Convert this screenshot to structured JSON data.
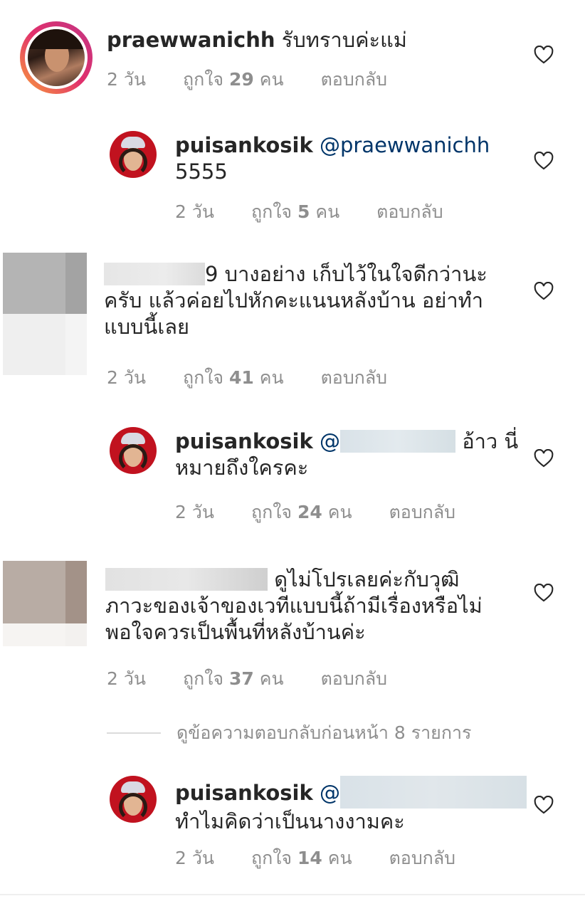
{
  "colors": {
    "text": "#262626",
    "meta": "#8e8e8e",
    "mention": "#003569",
    "divider": "#dbdbdb"
  },
  "comments": [
    {
      "user": "praewwanichh",
      "text": "รับทราบค่ะแม่",
      "time": "2 วัน",
      "likes_prefix": "ถูกใจ",
      "likes_count": "29",
      "likes_suffix": "คน",
      "reply": "ตอบกลับ"
    },
    {
      "user": "puisankosik",
      "mention": "@praewwanichh",
      "text": "5555",
      "time": "2 วัน",
      "likes_prefix": "ถูกใจ",
      "likes_count": "5",
      "likes_suffix": "คน",
      "reply": "ตอบกลับ"
    },
    {
      "text_line1": "9 บางอย่าง เก็บไว้ในใจดีกว่านะ",
      "text_line2": "ครับ แล้วค่อยไปหักคะแนนหลังบ้าน อย่าทำ",
      "text_line3": "แบบนี้เลย",
      "time": "2 วัน",
      "likes_prefix": "ถูกใจ",
      "likes_count": "41",
      "likes_suffix": "คน",
      "reply": "ตอบกลับ"
    },
    {
      "user": "puisankosik",
      "mention": "@",
      "text_line1": "อ้าว นี่",
      "text_line2": "หมายถึงใครคะ",
      "time": "2 วัน",
      "likes_prefix": "ถูกใจ",
      "likes_count": "24",
      "likes_suffix": "คน",
      "reply": "ตอบกลับ"
    },
    {
      "text_line1": "ดูไม่โปรเลยค่ะกับวุฒิ",
      "text_line2": "ภาวะของเจ้าของเวทีแบบนี้ถ้ามีเรื่องหรือไม่",
      "text_line3": "พอใจควรเป็นพื้นที่หลังบ้านค่ะ",
      "time": "2 วัน",
      "likes_prefix": "ถูกใจ",
      "likes_count": "37",
      "likes_suffix": "คน",
      "reply": "ตอบกลับ"
    },
    {
      "user": "puisankosik",
      "mention": "@",
      "text": "ทำไมคิดว่าเป็นนางงามคะ",
      "time": "2 วัน",
      "likes_prefix": "ถูกใจ",
      "likes_count": "14",
      "likes_suffix": "คน",
      "reply": "ตอบกลับ"
    }
  ],
  "view_previous": "ดูข้อความตอบกลับก่อนหน้า 8 รายการ",
  "icons": {
    "like": "heart-outline-icon"
  }
}
